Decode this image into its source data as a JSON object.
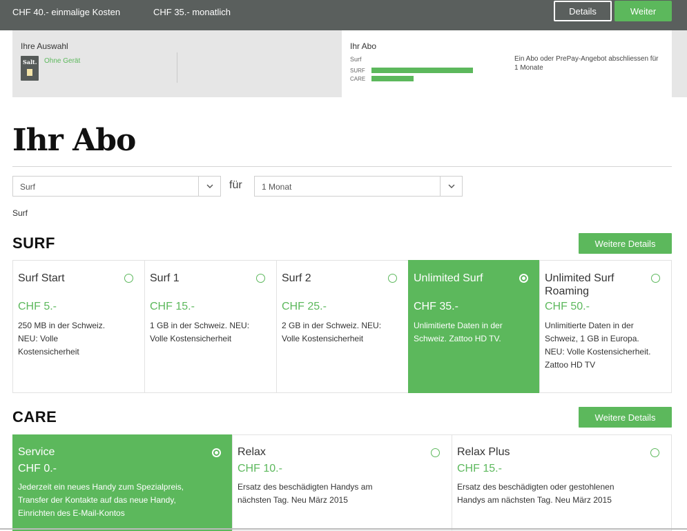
{
  "topbar": {
    "one_time_cost": "CHF 40.- einmalige Kosten",
    "monthly_cost": "CHF 35.- monatlich",
    "details_label": "Details",
    "next_label": "Weiter"
  },
  "summary": {
    "selection_title": "Ihre Auswahl",
    "device_logo_text": "Salt.",
    "device_label": "Ohne Gerät",
    "abo_title": "Ihr Abo",
    "abo_name": "Surf",
    "bars": [
      {
        "label": "SURF",
        "level": 0.8
      },
      {
        "label": "CARE",
        "level": 0.33
      }
    ],
    "note": "Ein Abo oder PrePay-Angebot abschliessen für 1 Monate"
  },
  "page": {
    "title": "Ihr Abo",
    "select_type": "Surf",
    "for_label": "für",
    "select_duration": "1 Monat",
    "breadcrumb": "Surf"
  },
  "surf": {
    "title": "SURF",
    "more_details": "Weitere Details",
    "plans": [
      {
        "name": "Surf Start",
        "price": "CHF 5.-",
        "desc": "250 MB in der Schweiz. NEU: Volle Kostensicherheit",
        "selected": false
      },
      {
        "name": "Surf 1",
        "price": "CHF 15.-",
        "desc": "1 GB in der Schweiz. NEU: Volle Kostensicherheit",
        "selected": false
      },
      {
        "name": "Surf 2",
        "price": "CHF 25.-",
        "desc": "2 GB in der Schweiz. NEU: Volle Kostensicherheit",
        "selected": false
      },
      {
        "name": "Unlimited Surf",
        "price": "CHF 35.-",
        "desc": "Unlimitierte Daten in der Schweiz. Zattoo HD TV.",
        "selected": true
      },
      {
        "name": "Unlimited Surf Roaming",
        "price": "CHF 50.-",
        "desc": "Unlimitierte Daten in der Schweiz, 1 GB in Europa. NEU: Volle Kostensicherheit. Zattoo HD TV",
        "selected": false
      }
    ]
  },
  "care": {
    "title": "CARE",
    "more_details": "Weitere Details",
    "plans": [
      {
        "name": "Service",
        "price": "CHF 0.-",
        "desc": "Jederzeit ein neues Handy zum Spezialpreis, Transfer der Kontakte auf das neue Handy, Einrichten des E-Mail-Kontos",
        "selected": true
      },
      {
        "name": "Relax",
        "price": "CHF 10.-",
        "desc": "Ersatz des beschädigten Handys am nächsten Tag. Neu März 2015",
        "selected": false
      },
      {
        "name": "Relax Plus",
        "price": "CHF 15.-",
        "desc": "Ersatz des beschädigten oder gestohlenen Handys am nächsten Tag. Neu März 2015",
        "selected": false
      }
    ]
  },
  "colors": {
    "accent": "#5cb85c",
    "topbar": "#5a5f5d",
    "summary_bg": "#e6e6e6"
  }
}
